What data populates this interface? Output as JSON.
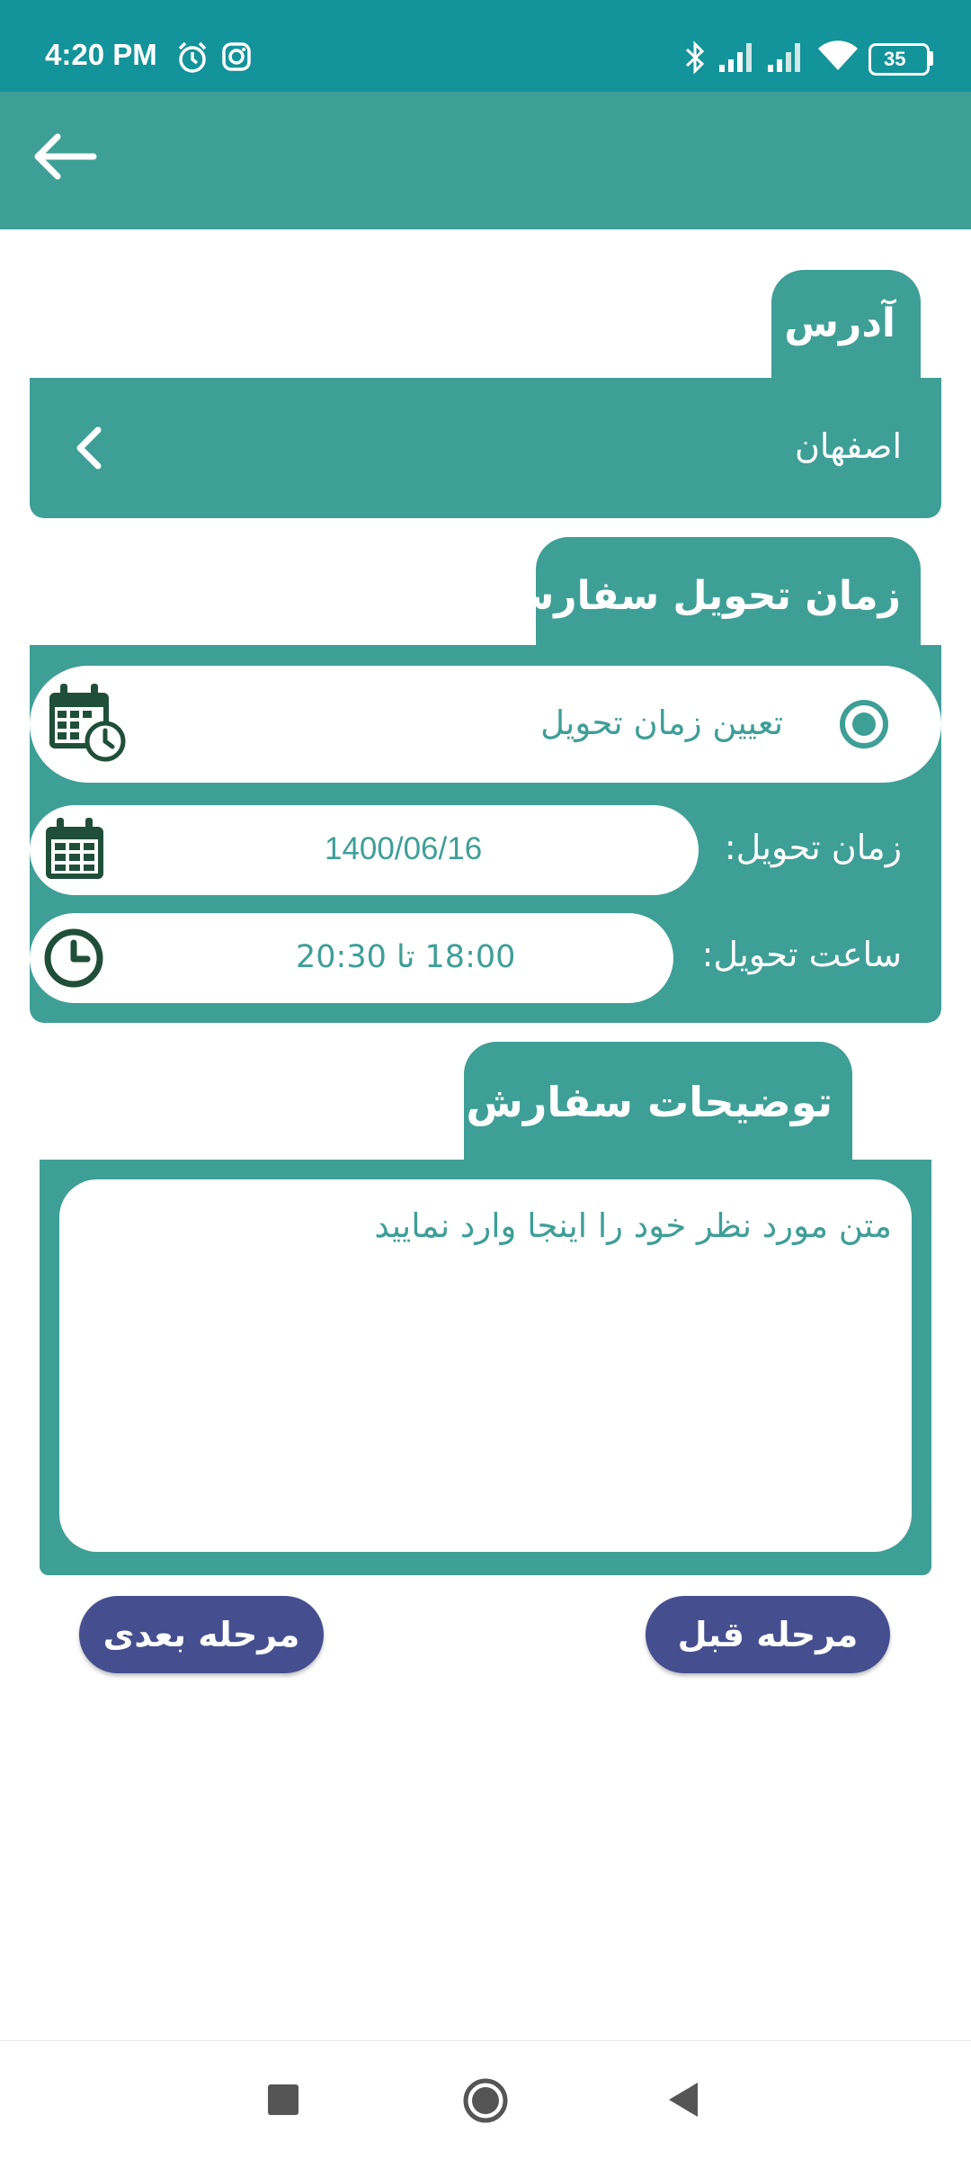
{
  "status_bar": {
    "time": "4:20 PM",
    "battery": "35"
  },
  "address_section": {
    "title": "آدرس",
    "value": "اصفهان"
  },
  "delivery_section": {
    "title": "زمان تحویل سفارش",
    "set_time_option": "تعیین زمان تحویل",
    "date_label": "زمان تحویل:",
    "date_value": "1400/06/16",
    "hour_label": "ساعت تحویل:",
    "hour_value": "18:00 تا 20:30"
  },
  "notes_section": {
    "title": "توضیحات سفارش",
    "placeholder": "متن مورد نظر خود را اینجا وارد نمایید"
  },
  "buttons": {
    "next": "مرحله بعدی",
    "previous": "مرحله قبل"
  },
  "colors": {
    "status_bar": "#13939a",
    "primary": "#3e9f97",
    "icon_dark": "#1f4f3a",
    "button": "#454f8f"
  }
}
